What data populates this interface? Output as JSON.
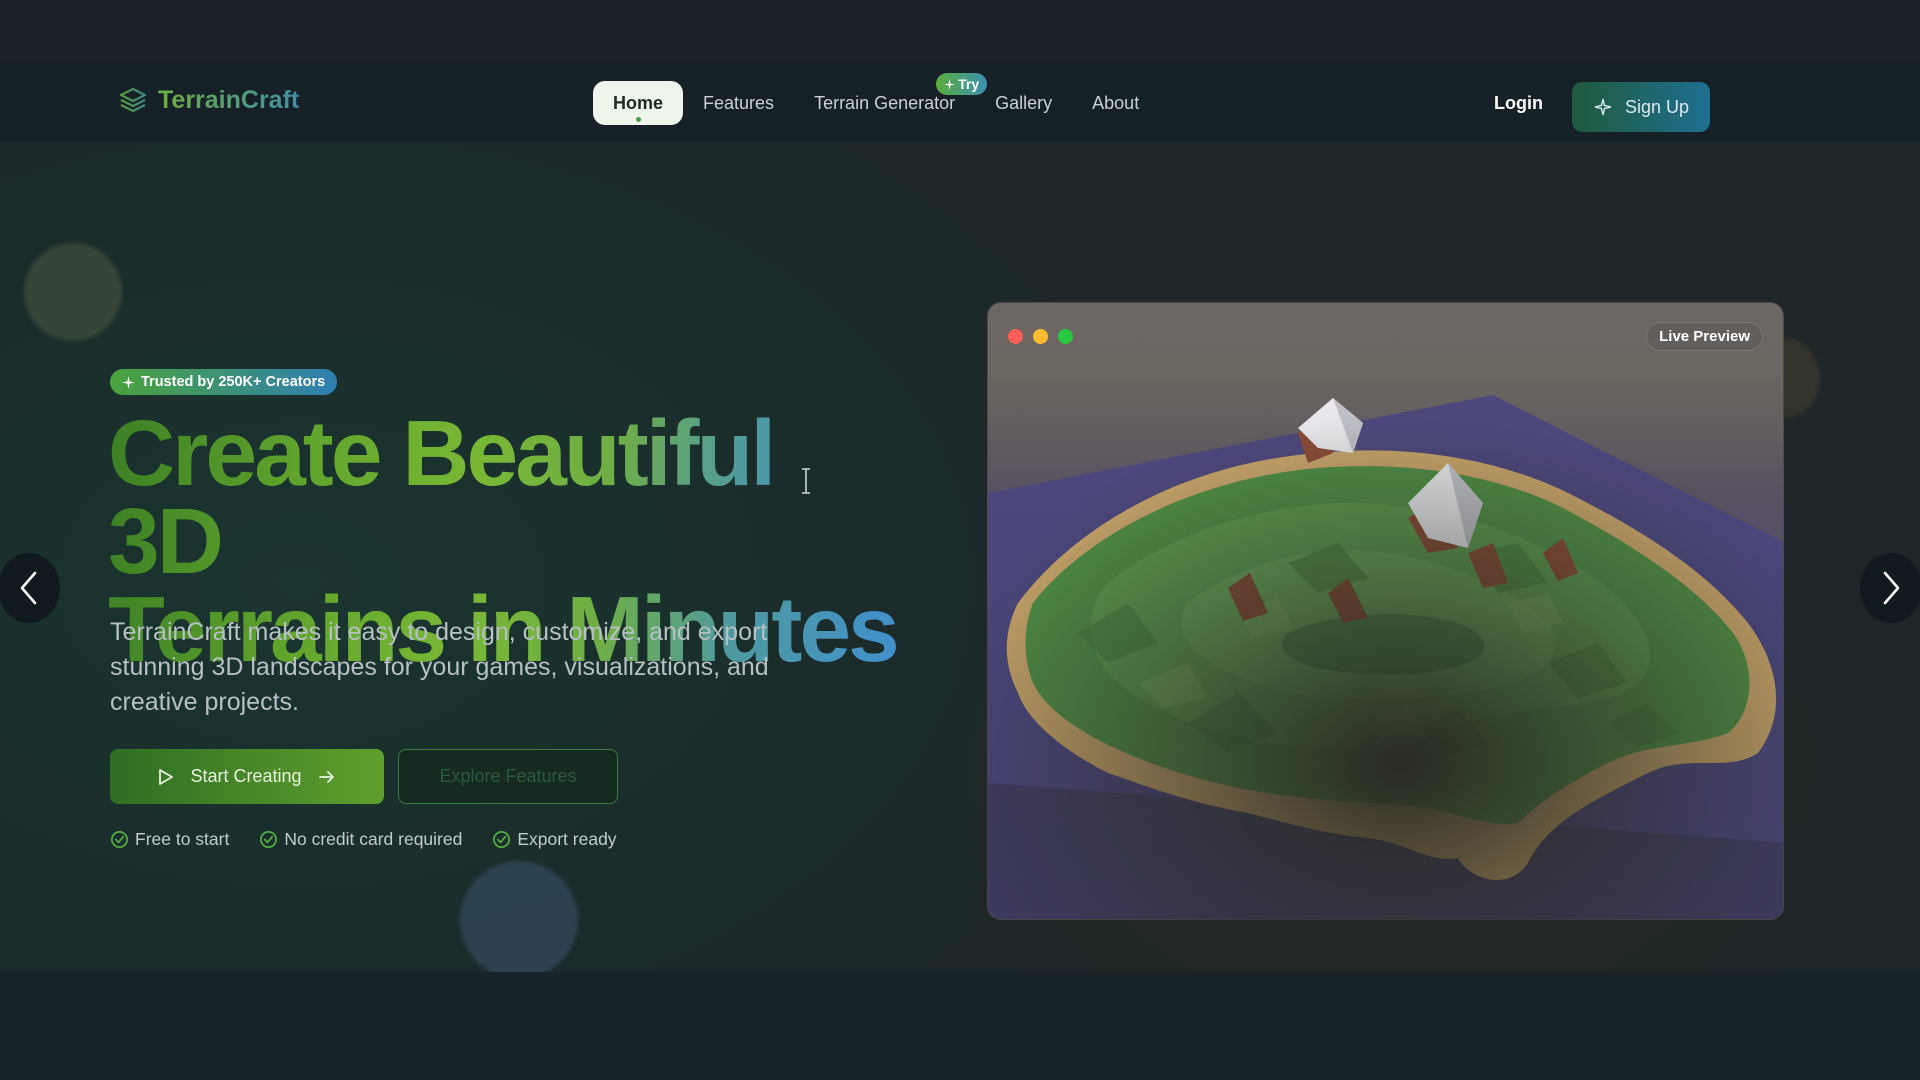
{
  "brand": {
    "name": "TerrainCraft",
    "icon": "layers-icon"
  },
  "nav": {
    "links": [
      {
        "label": "Home",
        "active": true
      },
      {
        "label": "Features"
      },
      {
        "label": "Terrain Generator",
        "badge": "Try"
      },
      {
        "label": "Gallery"
      },
      {
        "label": "About"
      }
    ],
    "login": "Login",
    "signup": "Sign Up"
  },
  "hero": {
    "badge": "Trusted by 250K+ Creators",
    "headline_line1": "Create Beautiful 3D",
    "headline_line2": "Terrains in Minutes",
    "subtext": "TerrainCraft makes it easy to design, customize, and export stunning 3D landscapes for your games, visualizations, and creative projects.",
    "primary_cta": "Start Creating",
    "secondary_cta": "Explore Features",
    "checks": [
      "Free to start",
      "No credit card required",
      "Export ready"
    ]
  },
  "preview": {
    "label": "Live Preview"
  },
  "colors": {
    "accent_green": "#5aa33a",
    "accent_blue": "#3b8fb1",
    "window_red": "#ff5f57",
    "window_yellow": "#febc2e",
    "window_green": "#28c840"
  }
}
